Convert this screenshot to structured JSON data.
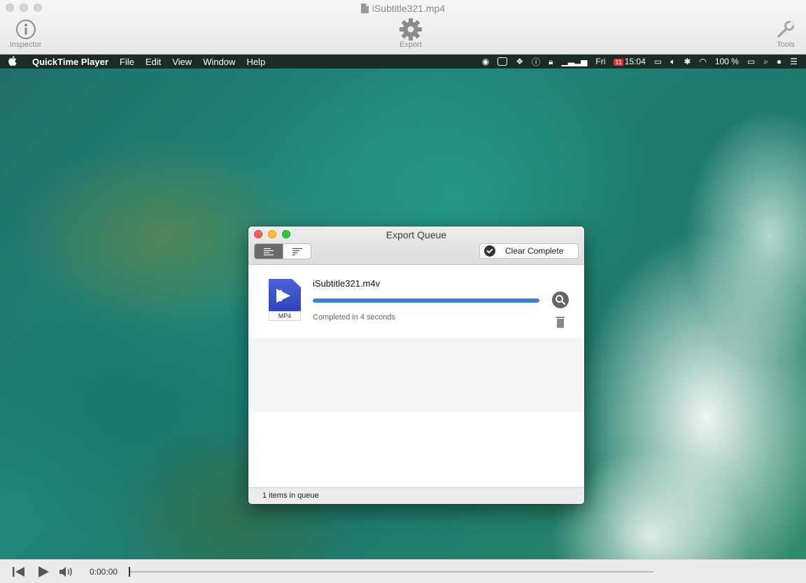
{
  "window": {
    "title": "iSubtitle321.mp4",
    "toolbar": {
      "inspector_label": "Inspector",
      "export_label": "Export",
      "tools_label": "Tools"
    }
  },
  "menubar": {
    "app_name": "QuickTime Player",
    "items": [
      "File",
      "Edit",
      "View",
      "Window",
      "Help"
    ],
    "day": "Fri",
    "calendar_date": "11",
    "time": "15:04",
    "battery": "100 %"
  },
  "export_queue": {
    "title": "Export Queue",
    "clear_complete_label": "Clear Complete",
    "item": {
      "file_name": "iSubtitle321.m4v",
      "file_type": "MP4",
      "progress": 1.0,
      "status": "Completed in 4 seconds"
    },
    "footer": "1 items in queue"
  },
  "transport": {
    "current_time": "0:00:00"
  },
  "colors": {
    "progress_fill": "#3a7ee0",
    "file_icon": "#3a51c8"
  }
}
